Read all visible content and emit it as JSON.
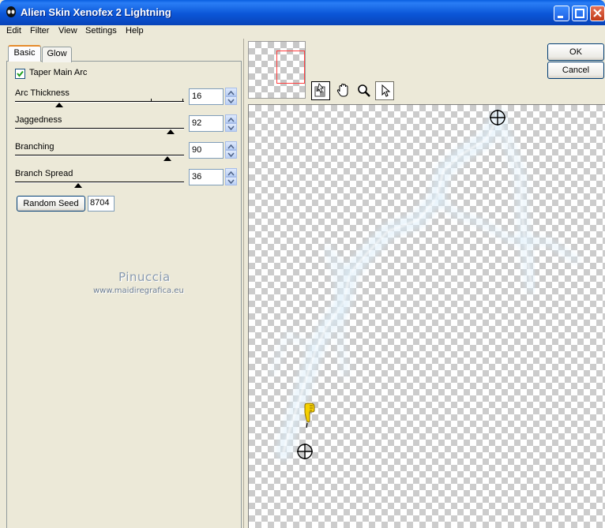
{
  "window": {
    "title": "Alien Skin Xenofex 2 Lightning",
    "icon": "alien-head-icon"
  },
  "menu": [
    "Edit",
    "Filter",
    "View",
    "Settings",
    "Help"
  ],
  "tabs": [
    {
      "label": "Basic",
      "active": true
    },
    {
      "label": "Glow",
      "active": false
    }
  ],
  "basic": {
    "taper_main_arc": {
      "label": "Taper Main Arc",
      "checked": true
    },
    "params": [
      {
        "label": "Arc Thickness",
        "value": "16"
      },
      {
        "label": "Jaggedness",
        "value": "92"
      },
      {
        "label": "Branching",
        "value": "90"
      },
      {
        "label": "Branch Spread",
        "value": "36"
      }
    ],
    "random_seed": {
      "label": "Random Seed",
      "value": "8704"
    }
  },
  "watermark": {
    "name": "Pinuccia",
    "url": "www.maidiregrafica.eu"
  },
  "buttons": {
    "ok": "OK",
    "cancel": "Cancel"
  },
  "toolbar": [
    "preview-toggle-icon",
    "hand-icon",
    "zoom-icon",
    "arrow-pointer-icon"
  ],
  "colors": {
    "titlebar": "#0b56d8",
    "lightning": "#dceefa",
    "selection_frame": "#ff4040",
    "cursor_hand": "#f5d000"
  }
}
